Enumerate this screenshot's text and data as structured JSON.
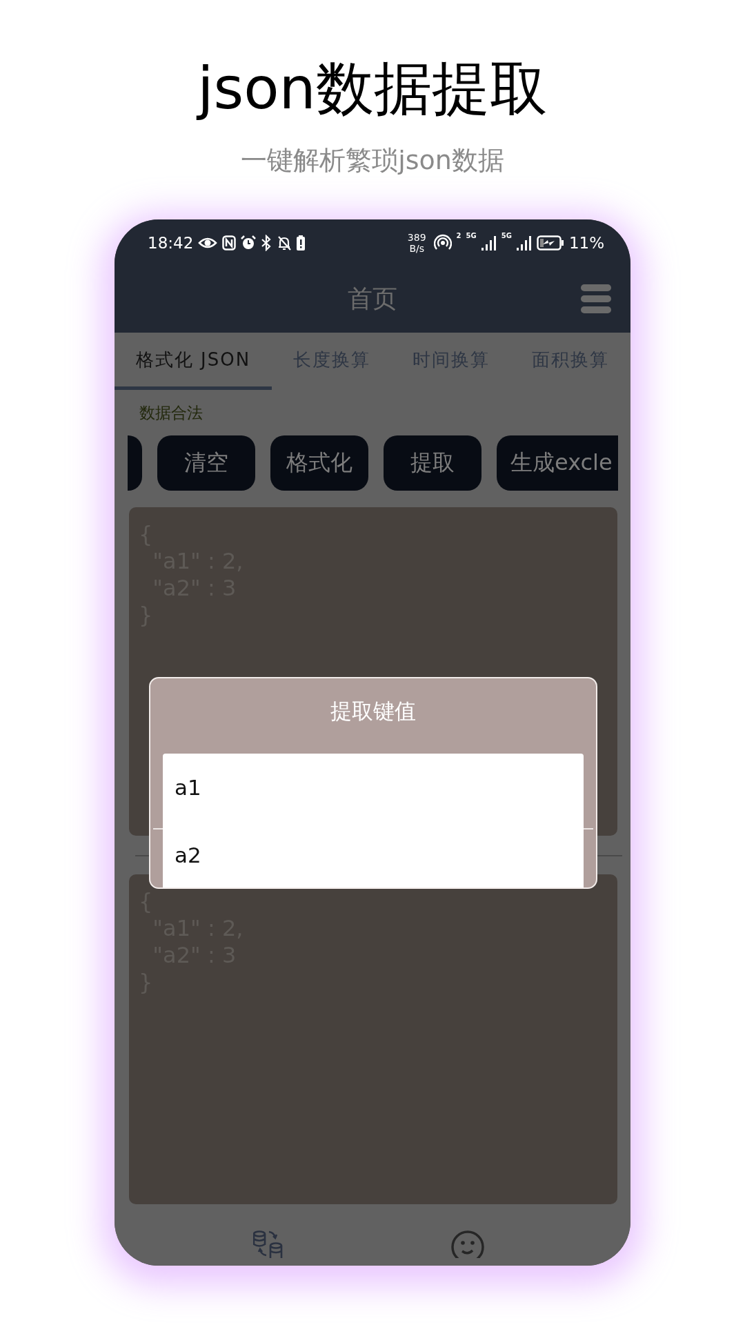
{
  "headline": "json数据提取",
  "subheadline": "一键解析繁琐json数据",
  "status_bar": {
    "time": "18:42",
    "speed_value": "389",
    "speed_unit": "B/s",
    "hotspot_count": "2",
    "sim1": "5G",
    "sim2": "5G",
    "battery": "11%"
  },
  "app_bar": {
    "title": "首页"
  },
  "tabs": [
    {
      "label": "格式化 JSON",
      "selected": true
    },
    {
      "label": "长度换算",
      "selected": false
    },
    {
      "label": "时间换算",
      "selected": false
    },
    {
      "label": "面积换算",
      "selected": false
    }
  ],
  "validity_message": "数据合法",
  "buttons": [
    "清空",
    "格式化",
    "提取",
    "生成excle"
  ],
  "input_lines": [
    "{",
    "  \"a1\" : 2,",
    "  \"a2\" : 3",
    "}"
  ],
  "output_lines": [
    "{",
    "  \"a1\" : 2,",
    "  \"a2\" : 3",
    "}"
  ],
  "dialog": {
    "title": "提取键值",
    "items": [
      "a1",
      "a2"
    ]
  }
}
